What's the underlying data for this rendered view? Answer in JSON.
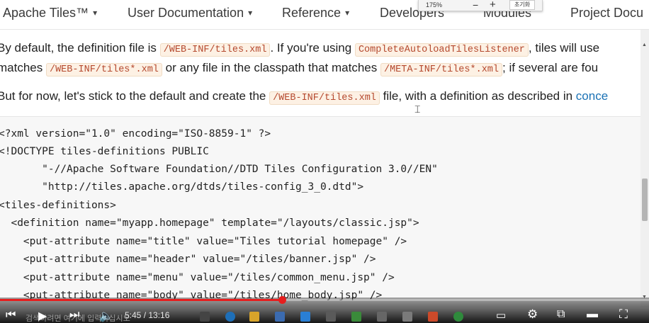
{
  "nav": {
    "items": [
      {
        "label": "Apache Tiles™",
        "caret": "▾"
      },
      {
        "label": "User Documentation",
        "caret": "▾"
      },
      {
        "label": "Reference",
        "caret": "▾"
      },
      {
        "label": "Developers",
        "caret": ""
      },
      {
        "label": "Modules",
        "caret": ""
      },
      {
        "label": "Project Docu",
        "caret": ""
      }
    ]
  },
  "zoom": {
    "level": "175%",
    "minus": "−",
    "plus": "+",
    "reset": "초기화"
  },
  "para1": {
    "t1": "By default, the definition file is ",
    "c1": "/WEB-INF/tiles.xml",
    "t2": ". If you're using ",
    "c2": "CompleteAutoloadTilesListener",
    "t3": ", tiles will use"
  },
  "para2": {
    "t1": "matches ",
    "c1": "/WEB-INF/tiles*.xml",
    "t2": " or any file in the classpath that matches ",
    "c2": "/META-INF/tiles*.xml",
    "t3": "; if several are fou"
  },
  "para3": {
    "t1": "But for now, let's stick to the default and create the ",
    "c1": "/WEB-INF/tiles.xml",
    "t2": " file, with a definition as described in ",
    "link": "conce"
  },
  "code": {
    "lines": [
      "<?xml version=\"1.0\" encoding=\"ISO-8859-1\" ?>",
      "<!DOCTYPE tiles-definitions PUBLIC",
      "       \"-//Apache Software Foundation//DTD Tiles Configuration 3.0//EN\"",
      "       \"http://tiles.apache.org/dtds/tiles-config_3_0.dtd\">",
      "<tiles-definitions>",
      "  <definition name=\"myapp.homepage\" template=\"/layouts/classic.jsp\">",
      "    <put-attribute name=\"title\" value=\"Tiles tutorial homepage\" />",
      "    <put-attribute name=\"header\" value=\"/tiles/banner.jsp\" />",
      "    <put-attribute name=\"menu\" value=\"/tiles/common_menu.jsp\" />",
      "    <put-attribute name=\"body\" value=\"/tiles/home_body.jsp\" />"
    ]
  },
  "video": {
    "time": "5:45 / 13:16",
    "progress": 0.434,
    "search_hint": "검색하려면 여기에 입력하십시오"
  },
  "colors": {
    "accent": "#e61e1e",
    "link": "#1a72b5",
    "inline_code": "#b5492e"
  }
}
